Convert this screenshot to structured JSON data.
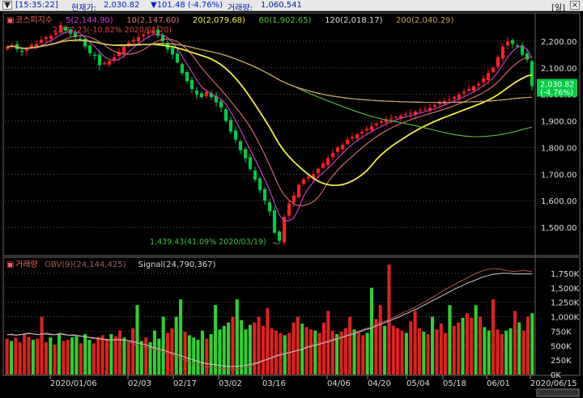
{
  "header": {
    "title_icon": "chevron-down-icon",
    "time": "[15:35:22]",
    "price_label": "현재가:",
    "price": "2,030.82",
    "change": "▼101.48 (-4.76%)",
    "volume_label": "거래량:",
    "volume": "1,060,541",
    "corner_label": "[일]",
    "colors": {
      "down": "#0022dd",
      "text": "#0022aa"
    }
  },
  "price_legend": {
    "checkbox": "▣",
    "name": "코스피지수",
    "items": [
      {
        "text": "5(2,144.90)",
        "color": "#d040d0"
      },
      {
        "text": "10(2,147.60)",
        "color": "#e07070"
      },
      {
        "text": "20(2,079.68)",
        "color": "#f0f040"
      },
      {
        "text": "60(1,902.65)",
        "color": "#60c040"
      },
      {
        "text": "120(2,018.17)",
        "color": "#dddddd"
      },
      {
        "text": "200(2,040.29)",
        "color": "#c8a060"
      }
    ]
  },
  "volume_legend": {
    "checkbox": "▣",
    "name": "거래량",
    "items": [
      {
        "text": "OBV(9)(24,144,425)",
        "color": "#a06060"
      },
      {
        "text": "Signal(24,790,367)",
        "color": "#dddddd"
      }
    ]
  },
  "annotations": {
    "high": "2,277.23(-10.82% 2020/01/20)",
    "low": "1,439.43(41.09% 2020/03/19)",
    "current_price": "2,030.82",
    "current_change": "(-4.76%)"
  },
  "chart_data": [
    {
      "type": "candlestick",
      "title": "코스피지수",
      "ylim": [
        1400,
        2300
      ],
      "y_ticks": [
        "2,200.00",
        "2,100.00",
        "2,000.00",
        "1,900.00",
        "1,800.00",
        "1,700.00",
        "1,600.00",
        "1,500.00"
      ],
      "y_tick_values": [
        2200,
        2100,
        2000,
        1900,
        1800,
        1700,
        1600,
        1500
      ],
      "x_labels": [
        "2020/01/06",
        "02/03",
        "02/17",
        "03/02",
        "03/16",
        "04/06",
        "04/20",
        "05/04",
        "05/18",
        "06/01",
        "2020/06/15"
      ],
      "close": [
        2178,
        2185,
        2170,
        2160,
        2172,
        2185,
        2190,
        2205,
        2215,
        2220,
        2230,
        2260,
        2240,
        2228,
        2215,
        2205,
        2180,
        2155,
        2145,
        2110,
        2118,
        2125,
        2140,
        2160,
        2178,
        2195,
        2205,
        2215,
        2225,
        2235,
        2240,
        2220,
        2200,
        2170,
        2150,
        2120,
        2080,
        2050,
        2020,
        2000,
        1990,
        2010,
        1990,
        1970,
        1950,
        1900,
        1860,
        1830,
        1790,
        1760,
        1720,
        1680,
        1640,
        1600,
        1560,
        1480,
        1450,
        1540,
        1590,
        1620,
        1660,
        1680,
        1690,
        1700,
        1720,
        1740,
        1760,
        1780,
        1800,
        1810,
        1830,
        1840,
        1850,
        1860,
        1870,
        1880,
        1890,
        1900,
        1905,
        1910,
        1915,
        1920,
        1925,
        1930,
        1935,
        1940,
        1945,
        1950,
        1960,
        1970,
        1975,
        1980,
        1990,
        2000,
        2010,
        2020,
        2030,
        2040,
        2060,
        2080,
        2100,
        2140,
        2180,
        2200,
        2190,
        2180,
        2150,
        2131,
        2030.82
      ],
      "ma_periods": [
        "5",
        "10",
        "20",
        "60",
        "120",
        "200"
      ],
      "ma_colors": [
        "#d040d0",
        "#e07070",
        "#f0f040",
        "#60c040",
        "#dddddd",
        "#c8a060"
      ]
    },
    {
      "type": "bar",
      "title": "거래량",
      "ylim": [
        0,
        2000
      ],
      "y_ticks": [
        "1,750K",
        "1,500K",
        "1,250K",
        "1,000K",
        "750K",
        "500K",
        "250K",
        "0K"
      ],
      "y_tick_values": [
        1750,
        1500,
        1250,
        1000,
        750,
        500,
        250,
        0
      ],
      "values": [
        620,
        580,
        640,
        560,
        700,
        650,
        600,
        620,
        1000,
        560,
        640,
        520,
        700,
        580,
        600,
        640,
        660,
        540,
        700,
        600,
        540,
        650,
        680,
        620,
        700,
        660,
        760,
        640,
        560,
        800,
        1200,
        580,
        640,
        560,
        760,
        620,
        1000,
        720,
        800,
        1000,
        1300,
        740,
        680,
        640,
        600,
        760,
        620,
        700,
        1200,
        780,
        840,
        900,
        1000,
        1300,
        940,
        780,
        860,
        900,
        1000,
        840,
        1150,
        800,
        760,
        720,
        680,
        720,
        900,
        1000,
        880,
        820,
        780,
        760,
        720,
        900,
        1100,
        760,
        700,
        740,
        800,
        1000,
        780,
        720,
        680,
        720,
        1500,
        960,
        1200,
        840,
        1900,
        840,
        800,
        760,
        720,
        920,
        1100,
        800,
        740,
        700,
        1000,
        780,
        880,
        720,
        1200,
        840,
        900,
        980,
        1060,
        980,
        1200,
        1000,
        820,
        760,
        1300,
        780,
        700,
        760,
        800,
        1100,
        900,
        760,
        1000,
        1060
      ],
      "up": [
        1,
        0,
        1,
        1,
        1,
        1,
        0,
        1,
        1,
        1,
        0,
        1,
        0,
        1,
        1,
        0,
        0,
        1,
        0,
        0,
        1,
        1,
        1,
        1,
        0,
        1,
        1,
        0,
        1,
        1,
        0,
        0,
        1,
        0,
        0,
        0,
        0,
        1,
        1,
        0,
        0,
        1,
        0,
        0,
        0,
        0,
        1,
        0,
        0,
        0,
        0,
        0,
        1,
        0,
        0,
        0,
        0,
        1,
        1,
        1,
        1,
        1,
        1,
        1,
        0,
        1,
        1,
        1,
        0,
        1,
        1,
        0,
        1,
        1,
        1,
        1,
        0,
        1,
        1,
        1,
        0,
        1,
        1,
        0,
        0,
        1,
        1,
        0,
        1,
        1,
        1,
        1,
        0,
        1,
        1,
        1,
        0,
        1,
        0,
        1,
        1,
        1,
        0,
        1,
        1,
        0,
        1,
        1,
        0,
        1,
        0,
        0,
        1,
        1,
        1,
        0,
        0,
        1,
        0,
        1
      ],
      "obv": [
        690,
        700,
        680,
        690,
        710,
        720,
        700,
        690,
        700,
        720,
        700,
        690,
        720,
        700,
        680,
        690,
        680,
        660,
        650,
        630,
        620,
        610,
        600,
        590,
        600,
        620,
        600,
        580,
        560,
        520,
        500,
        480,
        460,
        440,
        420,
        400,
        380,
        360,
        330,
        300,
        260,
        230,
        200,
        170,
        150,
        130,
        130,
        120,
        110,
        100,
        90,
        90,
        100,
        110,
        120,
        140,
        170,
        200,
        230,
        270,
        300,
        340,
        360,
        380,
        380,
        400,
        420,
        450,
        480,
        520,
        540,
        560,
        570,
        590,
        610,
        640,
        660,
        690,
        710,
        730,
        760,
        790,
        810,
        840,
        880,
        910,
        930,
        970,
        1000,
        1040,
        1080,
        1110,
        1150,
        1190,
        1230,
        1270,
        1320,
        1360,
        1410,
        1460,
        1500,
        1540,
        1580,
        1620,
        1660,
        1700,
        1740,
        1770,
        1800,
        1820,
        1830,
        1830,
        1820,
        1800,
        1790,
        1780,
        1790,
        1800,
        1790,
        1780
      ],
      "signal": [
        690,
        690,
        680,
        690,
        700,
        710,
        700,
        690,
        700,
        700,
        690,
        690,
        700,
        690,
        680,
        680,
        670,
        660,
        650,
        640,
        630,
        620,
        610,
        600,
        600,
        600,
        600,
        590,
        580,
        560,
        540,
        520,
        500,
        470,
        450,
        430,
        410,
        380,
        360,
        330,
        310,
        280,
        260,
        230,
        210,
        190,
        180,
        170,
        160,
        150,
        140,
        140,
        140,
        150,
        160,
        170,
        190,
        210,
        240,
        260,
        290,
        320,
        340,
        360,
        380,
        400,
        420,
        440,
        470,
        490,
        510,
        530,
        550,
        570,
        600,
        620,
        640,
        670,
        690,
        720,
        740,
        770,
        790,
        820,
        850,
        880,
        910,
        940,
        970,
        1000,
        1040,
        1070,
        1110,
        1140,
        1180,
        1220,
        1260,
        1300,
        1340,
        1380,
        1420,
        1460,
        1500,
        1530,
        1570,
        1600,
        1630,
        1660,
        1690,
        1710,
        1730,
        1740,
        1750,
        1750,
        1750,
        1740,
        1740,
        1740,
        1740,
        1740
      ]
    }
  ],
  "styles": {
    "up_color": "#ff2020",
    "down_color": "#00cc44",
    "vol_up_color": "#e02020",
    "vol_down_color": "#30d030",
    "obv_color": "#b05050",
    "signal_color": "#cccccc",
    "axis_text": "#dddddd",
    "grid_color": "#555555",
    "annot_high_color": "#e04040",
    "annot_low_color": "#40c040",
    "current_box_color": "#00cc44"
  }
}
